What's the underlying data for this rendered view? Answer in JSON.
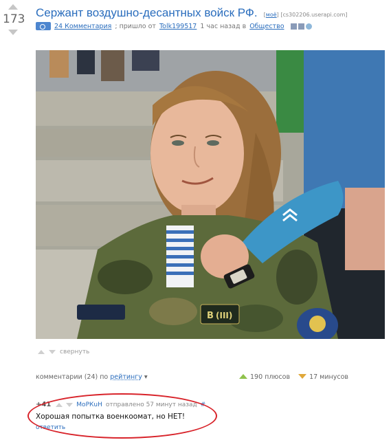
{
  "post": {
    "score": "173",
    "title": "Сержант воздушно-десантных войск РФ.",
    "tag_open": "[",
    "tag_mine": "моё",
    "tag_close": "]",
    "source": "[cs302206.userapi.com]",
    "comments_link": "24 Комментария",
    "meta_sent_from": "; пришло от",
    "author": "Tolk199517",
    "time_ago": "1 час назад в",
    "section": "Обществo"
  },
  "collapse": {
    "label": "свернуть"
  },
  "comments_bar": {
    "prefix": "комментарии (24) по",
    "sort_label": "рейтингу",
    "sort_caret": "▾",
    "plus_label": "190 плюсов",
    "minus_label": "17 минусов"
  },
  "comment": {
    "score": "+41",
    "user": "МоРКuН",
    "sent": "отправлено 57 минут назад",
    "anchor": "#",
    "text": "Хорошая попытка военкоомат, но НЕТ!",
    "reply": "ответить"
  },
  "colors": {
    "link": "#2a6dbd",
    "plus": "#8fc24c",
    "minus": "#e0a83a",
    "highlight": "#d8232a"
  }
}
